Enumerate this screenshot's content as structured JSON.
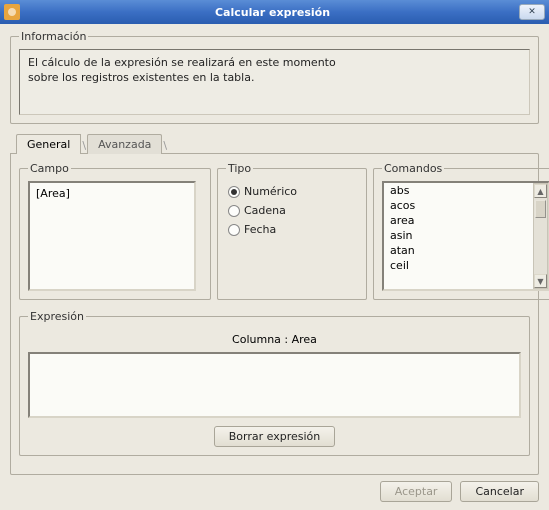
{
  "window": {
    "title": "Calcular expresión"
  },
  "info": {
    "legend": "Información",
    "line1": "El cálculo de la expresión se realizará en este momento",
    "line2": "sobre los registros existentes en la tabla."
  },
  "tabs": {
    "general": "General",
    "avanzada": "Avanzada"
  },
  "campo": {
    "legend": "Campo",
    "items": [
      "[Area]"
    ]
  },
  "tipo": {
    "legend": "Tipo",
    "options": {
      "numerico": "Numérico",
      "cadena": "Cadena",
      "fecha": "Fecha"
    },
    "selected": "numerico"
  },
  "comandos": {
    "legend": "Comandos",
    "items": [
      "abs",
      "acos",
      "area",
      "asin",
      "atan",
      "ceil"
    ]
  },
  "expresion": {
    "legend": "Expresión",
    "column_label": "Columna : Area",
    "clear_btn": "Borrar expresión"
  },
  "footer": {
    "aceptar": "Aceptar",
    "cancelar": "Cancelar"
  }
}
